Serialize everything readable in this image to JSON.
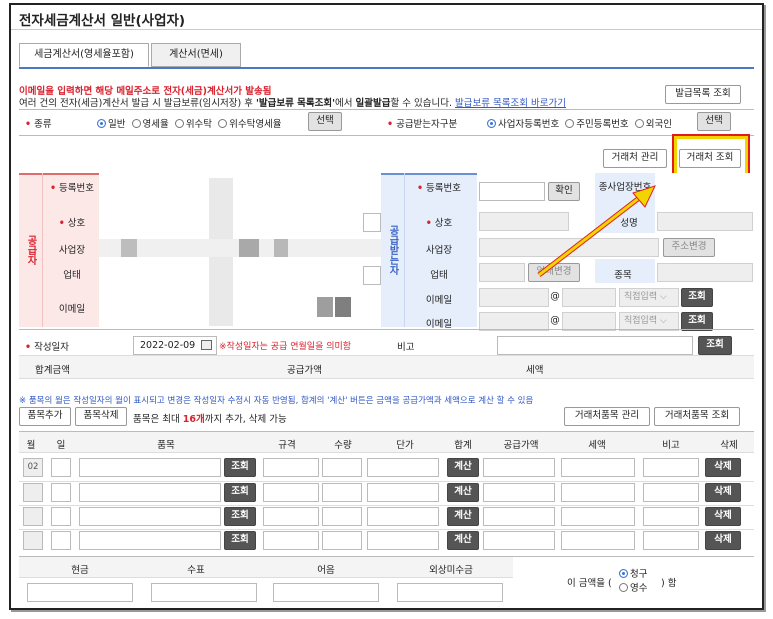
{
  "window_title": "전자세금계산서 일반(사업자)",
  "tabs": [
    {
      "label": "세금계산서(영세율포함)",
      "active": true
    },
    {
      "label": "계산서(면세)",
      "active": false
    }
  ],
  "notice": {
    "line1": "이메일을 입력하면 해당 메일주소로 전자(세금)계산서가 발송됨",
    "line2_a": "여러 건의 전자(세금)계산서 발급 시 발급보류(임시저장) 후 ",
    "line2_b": "'발급보류 목록조회'",
    "line2_c": "에서 ",
    "line2_d": "일괄발급",
    "line2_e": "할 수 있습니다.",
    "line2_link": "발급보류 목록조회 바로가기"
  },
  "buttons": {
    "issue_list": "발급목록 조회",
    "select": "선택",
    "partner_manage": "거래처 관리",
    "partner_lookup": "거래처 조회",
    "confirm": "확인",
    "address_change": "주소변경",
    "business_change": "업태변경",
    "lookup": "조회",
    "item_add": "품목추가",
    "item_delete": "품목삭제",
    "partner_item_manage": "거래처품목 관리",
    "partner_item_lookup": "거래처품목 조회",
    "calc": "계산",
    "delete": "삭제"
  },
  "kind": {
    "label": "종류",
    "options": [
      "일반",
      "영세율",
      "위수탁",
      "위수탁영세율"
    ],
    "selected": "일반"
  },
  "receiver_type": {
    "label": "공급받는자구분",
    "options": [
      "사업자등록번호",
      "주민등록번호",
      "외국인"
    ],
    "selected": "사업자등록번호"
  },
  "supplier": {
    "side_label": "공급자",
    "fields": [
      "등록번호",
      "상호",
      "사업장",
      "업태",
      "이메일"
    ]
  },
  "receiver": {
    "side_label": "공급받는자",
    "reg_label": "등록번호",
    "sub_reg_label": "종사업장번호",
    "name_label": "상호",
    "ceo_label": "성명",
    "address_label": "사업장",
    "business_label": "업태",
    "item_label": "종목",
    "email_label": "이메일",
    "at": "@",
    "direct_input": "직접입력"
  },
  "date": {
    "label": "작성일자",
    "value": "2022-02-09",
    "note": "※작성일자는 공급 연월일을 의미함",
    "memo_label": "비고"
  },
  "totals": {
    "total_label": "합계금액",
    "supply_label": "공급가액",
    "tax_label": "세액"
  },
  "items_note": "※ 품목의 월은 작성일자의 월이 표시되고 변경은 작성일자 수정시 자동 반영됨, 합계의 '계산' 버튼은 금액을 공급가액과 세액으로 계산 할 수 있음",
  "items_limit": {
    "prefix": "품목은 최대 ",
    "count": "16개",
    "suffix": "까지 추가, 삭제 가능"
  },
  "table_headers": [
    "월",
    "일",
    "품목",
    "규격",
    "수량",
    "단가",
    "합계",
    "공급가액",
    "세액",
    "비고",
    "삭제"
  ],
  "rows": [
    {
      "month": "02"
    },
    {
      "month": ""
    },
    {
      "month": ""
    },
    {
      "month": ""
    }
  ],
  "payment": {
    "headers": [
      "현금",
      "수표",
      "어음",
      "외상미수금"
    ],
    "claim_prefix": "이 금액을 (",
    "claim_options": [
      "청구",
      "영수"
    ],
    "claim_selected": "청구",
    "claim_suffix": ") 함"
  },
  "colors": {
    "red": "#d9232f",
    "blue_tab": "#4a78c2",
    "highlight_box": "#e21b1b",
    "highlight_fill": "#f2d500",
    "arrow": "#f2d500"
  }
}
